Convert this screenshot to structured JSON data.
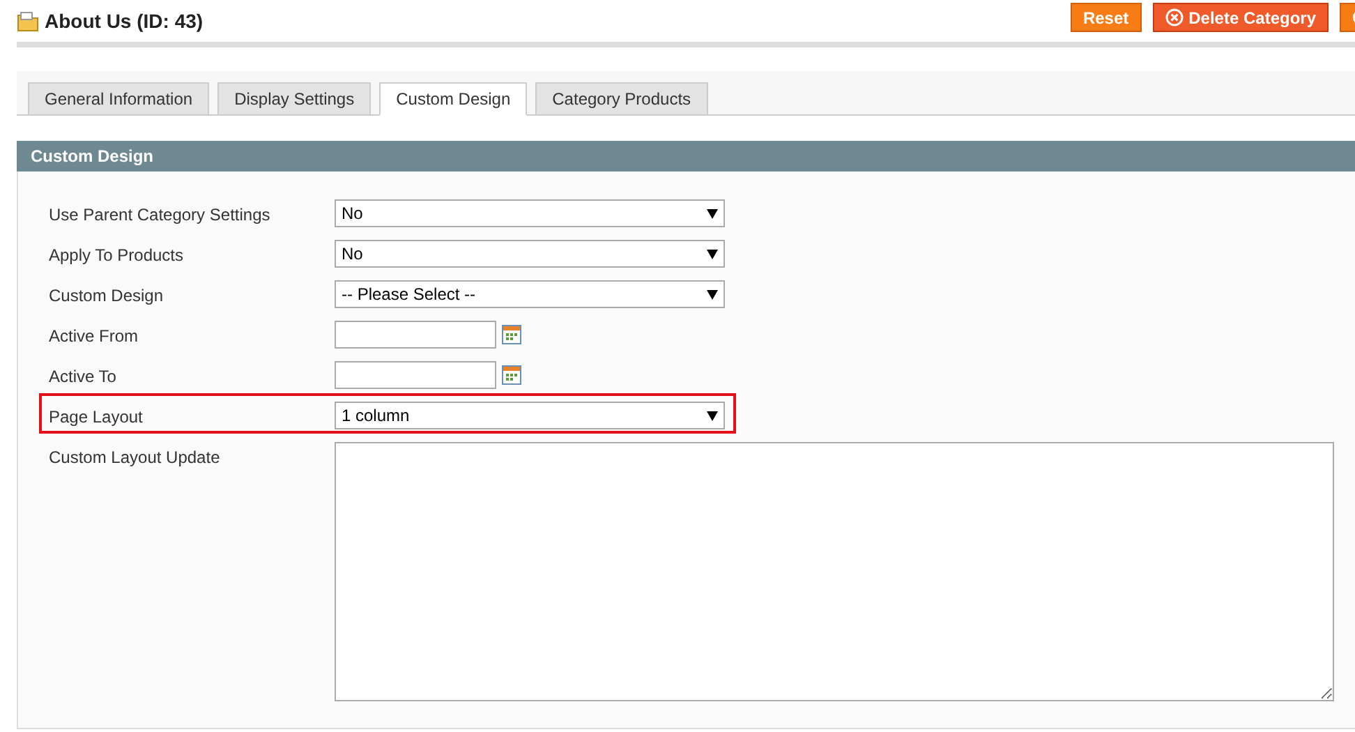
{
  "header": {
    "title": "About Us (ID: 43)",
    "buttons": [
      {
        "label": "Reset",
        "kind": "plain"
      },
      {
        "label": "Delete Category",
        "kind": "delete"
      },
      {
        "kind": "save"
      }
    ]
  },
  "tabs": [
    {
      "label": "General Information",
      "selected": false
    },
    {
      "label": "Display Settings",
      "selected": false
    },
    {
      "label": "Custom Design",
      "selected": true
    },
    {
      "label": "Category Products",
      "selected": false
    }
  ],
  "section": {
    "title": "Custom Design",
    "fields": [
      {
        "label": "Use Parent Category Settings",
        "kind": "select",
        "value": "No",
        "highlighted": false
      },
      {
        "label": "Apply To Products",
        "kind": "select",
        "value": "No",
        "highlighted": false
      },
      {
        "label": "Custom Design",
        "kind": "select",
        "value": "-- Please Select --",
        "highlighted": false
      },
      {
        "label": "Active From",
        "kind": "date",
        "highlighted": false
      },
      {
        "label": "Active To",
        "kind": "date",
        "highlighted": false
      },
      {
        "label": "Page Layout",
        "kind": "select",
        "value": "1 column",
        "highlighted": true
      },
      {
        "label": "Custom Layout Update",
        "kind": "textarea",
        "highlighted": false
      }
    ]
  }
}
